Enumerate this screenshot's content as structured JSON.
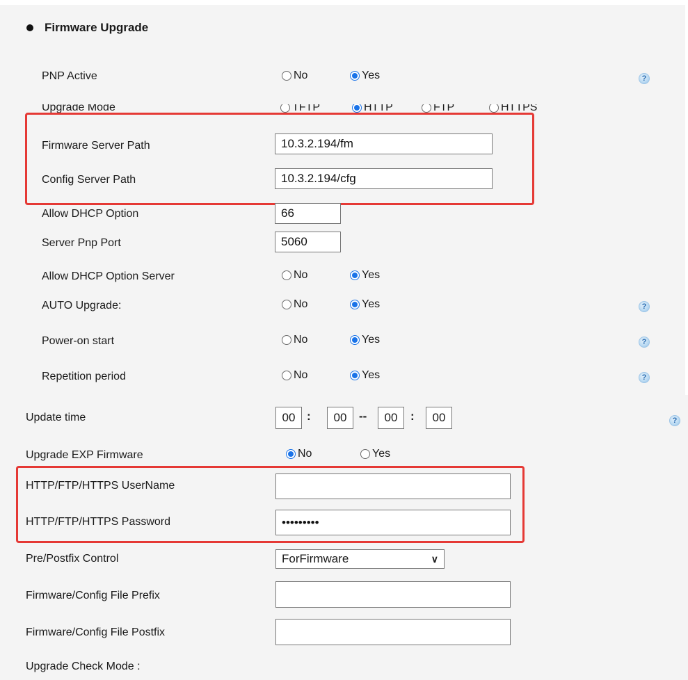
{
  "section_title": "Firmware Upgrade",
  "rows": {
    "pnp_active": {
      "label": "PNP Active",
      "no": "No",
      "yes": "Yes"
    },
    "upgrade_mode": {
      "label": "Upgrade Mode",
      "opt1": "TFTP",
      "opt2": "HTTP",
      "opt3": "FTP",
      "opt4": "HTTPS"
    },
    "firmware_server_path": {
      "label": "Firmware Server Path",
      "value": "10.3.2.194/fm"
    },
    "config_server_path": {
      "label": "Config Server Path",
      "value": "10.3.2.194/cfg"
    },
    "allow_dhcp_option": {
      "label": "Allow DHCP Option",
      "value": "66"
    },
    "server_pnp_port": {
      "label": "Server Pnp Port",
      "value": "5060"
    },
    "allow_dhcp_option_server": {
      "label": "Allow DHCP Option Server",
      "no": "No",
      "yes": "Yes"
    },
    "auto_upgrade": {
      "label": "AUTO Upgrade:",
      "no": "No",
      "yes": "Yes"
    },
    "power_on_start": {
      "label": "Power-on start",
      "no": "No",
      "yes": "Yes"
    },
    "repetition_period": {
      "label": "Repetition period",
      "no": "No",
      "yes": "Yes"
    },
    "update_time": {
      "label": "Update time",
      "h1": "00",
      "m1": "00",
      "h2": "00",
      "m2": "00",
      "colon": ":",
      "dash": "--"
    },
    "upgrade_exp_firmware": {
      "label": "Upgrade EXP Firmware",
      "no": "No",
      "yes": "Yes"
    },
    "http_username": {
      "label": "HTTP/FTP/HTTPS UserName",
      "value": ""
    },
    "http_password": {
      "label": "HTTP/FTP/HTTPS Password",
      "value": "•••••••••"
    },
    "pre_postfix_control": {
      "label": "Pre/Postfix Control",
      "selected": "ForFirmware"
    },
    "file_prefix": {
      "label": "Firmware/Config File Prefix",
      "value": ""
    },
    "file_postfix": {
      "label": "Firmware/Config File Postfix",
      "value": ""
    },
    "upgrade_check_mode": {
      "label": "Upgrade Check Mode :"
    }
  },
  "help_glyph": "?",
  "icons": {
    "help": "help-icon",
    "chevron": "chevron-down-icon",
    "bullet": "bullet-icon"
  },
  "colors": {
    "highlight": "#e53935",
    "radio_selected": "#1a73e8",
    "background": "#f4f4f4"
  }
}
